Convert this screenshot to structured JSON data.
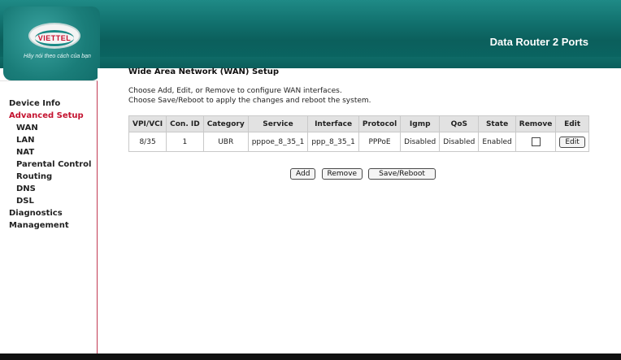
{
  "header": {
    "brand_logo_text": "VIETTEL",
    "slogan": "Hãy nói theo cách của bạn",
    "product_name": "Data Router 2 Ports",
    "colors": {
      "teal": "#0b5f5c",
      "accent_red": "#c4122f"
    }
  },
  "sidebar": {
    "items": [
      {
        "label": "Device Info"
      },
      {
        "label": "Advanced Setup"
      },
      {
        "label": "WAN"
      },
      {
        "label": "LAN"
      },
      {
        "label": "NAT"
      },
      {
        "label": "Parental Control"
      },
      {
        "label": "Routing"
      },
      {
        "label": "DNS"
      },
      {
        "label": "DSL"
      },
      {
        "label": "Diagnostics"
      },
      {
        "label": "Management"
      }
    ]
  },
  "main": {
    "title": "Wide Area Network (WAN) Setup",
    "desc_line1": "Choose Add, Edit, or Remove to configure WAN interfaces.",
    "desc_line2": "Choose Save/Reboot to apply the changes and reboot the system.",
    "table": {
      "headers": [
        "VPI/VCI",
        "Con. ID",
        "Category",
        "Service",
        "Interface",
        "Protocol",
        "Igmp",
        "QoS",
        "State",
        "Remove",
        "Edit"
      ],
      "rows": [
        {
          "vpi_vci": "8/35",
          "con_id": "1",
          "category": "UBR",
          "service": "pppoe_8_35_1",
          "interface": "ppp_8_35_1",
          "protocol": "PPPoE",
          "igmp": "Disabled",
          "qos": "Disabled",
          "state": "Enabled",
          "edit_label": "Edit"
        }
      ]
    },
    "buttons": {
      "add": "Add",
      "remove": "Remove",
      "save_reboot": "Save/Reboot"
    }
  }
}
